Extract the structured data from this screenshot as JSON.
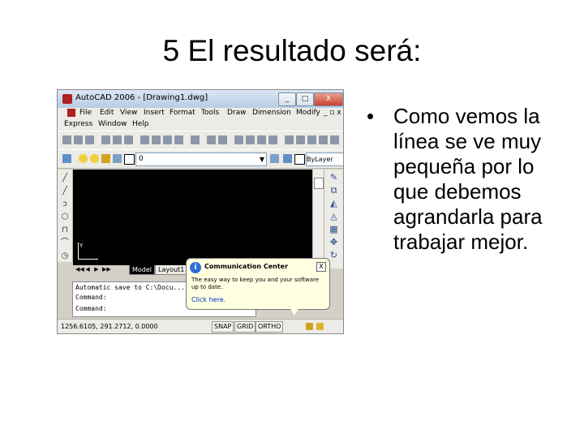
{
  "slide": {
    "title": "5 El resultado será:",
    "bullet_mark": "•",
    "bullet": "Como vemos la línea se ve muy pequeña por lo que debemos agrandarla para trabajar mejor."
  },
  "window": {
    "title": "AutoCAD 2006 - [Drawing1.dwg]",
    "minimize": "_",
    "maximize": "□",
    "close": "X"
  },
  "menu": {
    "items": [
      "File",
      "Edit",
      "View",
      "Insert",
      "Format",
      "Tools",
      "Draw",
      "Dimension",
      "Modify"
    ],
    "items_row2": [
      "Express",
      "Window",
      "Help"
    ],
    "doc_controls": "_ ▫ x"
  },
  "layer_toolbar": {
    "layer_value": "0",
    "dropdown_arrow": "▼",
    "linetype_value": "ByLayer"
  },
  "drawing": {
    "ucs_y": "Y",
    "tab_nav": [
      "◀◀",
      "◀",
      "▶",
      "▶▶"
    ],
    "tabs": [
      "Model",
      "Layout1"
    ]
  },
  "command_line": {
    "lines": [
      "Automatic save to C:\\Docu...",
      "Command:",
      "Command:"
    ]
  },
  "status": {
    "coords": "1256.6105, 291.2712, 0.0000",
    "buttons": [
      "SNAP",
      "GRID",
      "ORTHO"
    ]
  },
  "balloon": {
    "info_glyph": "i",
    "title": "Communication Center",
    "close": "X",
    "body": "The easy way to keep you and your software up to date.",
    "link": "Click here."
  },
  "colors": {
    "canvas": "#000000",
    "chrome": "#ecebe6",
    "balloon": "#ffffe1",
    "link": "#0033cc"
  }
}
